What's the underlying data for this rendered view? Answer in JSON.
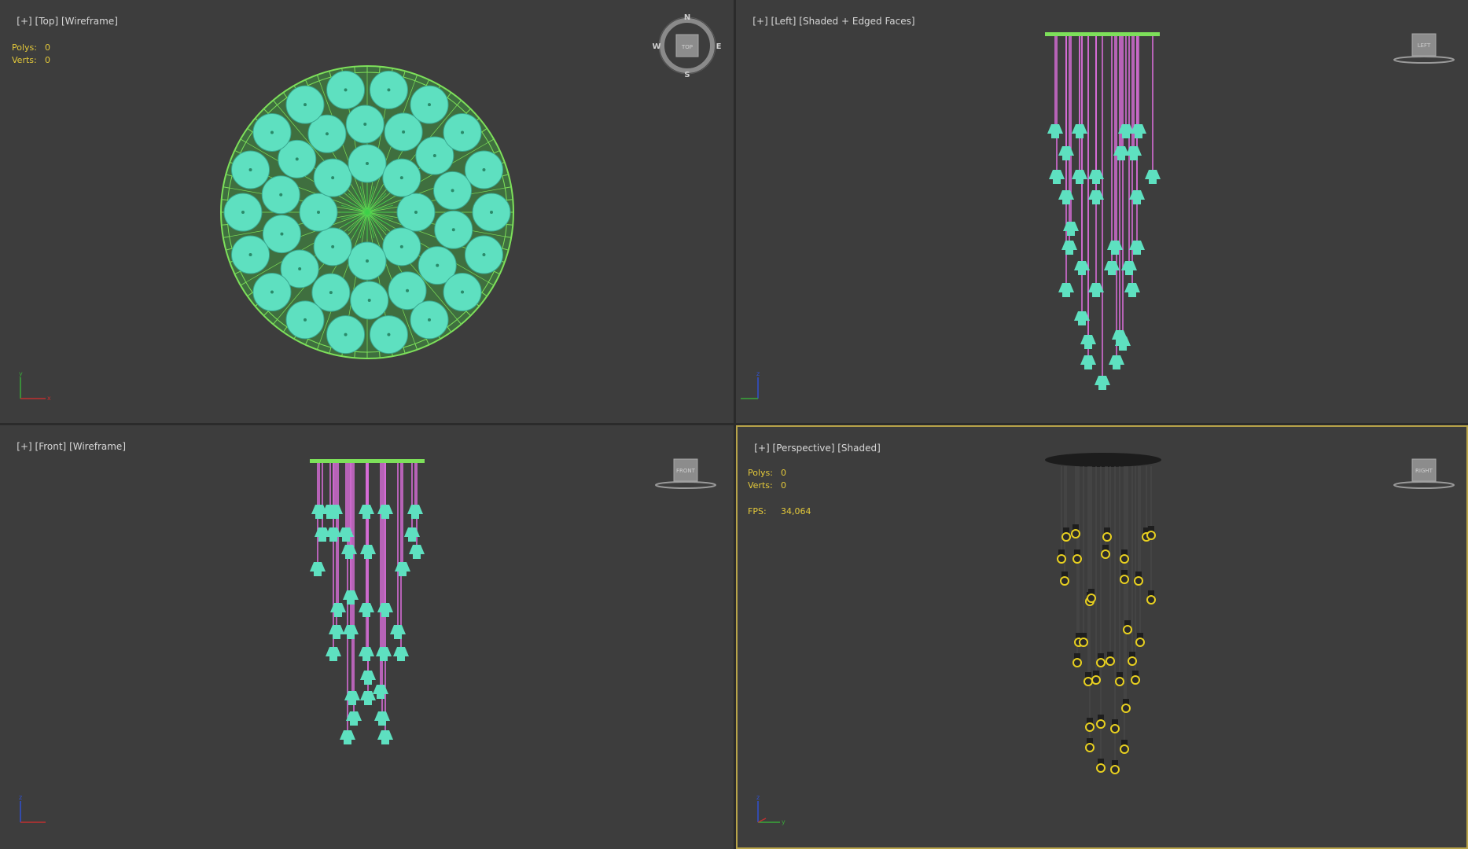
{
  "viewports": {
    "top": {
      "label": "[+] [Top] [Wireframe]",
      "label_parts": [
        "[+]",
        "[Top]",
        "[Wireframe]"
      ],
      "stats": {
        "polys_label": "Polys:",
        "polys": "0",
        "verts_label": "Verts:",
        "verts": "0"
      },
      "compass": {
        "n": "N",
        "s": "S",
        "e": "E",
        "w": "W",
        "center": "TOP"
      }
    },
    "left": {
      "label_parts": [
        "[+]",
        "[Left]",
        "[Shaded + Edged Faces]"
      ],
      "viewcube": "LEFT"
    },
    "front": {
      "label_parts": [
        "[+]",
        "[Front]",
        "[Wireframe]"
      ],
      "viewcube": "FRONT"
    },
    "perspective": {
      "label_parts": [
        "[+]",
        "[Perspective]",
        "[Shaded]"
      ],
      "viewcube": "RIGHT",
      "stats": {
        "polys_label": "Polys:",
        "polys": "0",
        "verts_label": "Verts:",
        "verts": "0",
        "fps_label": "FPS:",
        "fps": "34,064"
      }
    }
  },
  "colors": {
    "viewport_bg": "#3d3d3d",
    "wire_green": "#7de05a",
    "shade_cyan": "#5ee0c0",
    "cable_magenta": "#e070e0",
    "bulb_yellow": "#e8d020",
    "active_border": "#b8a44a",
    "stats_yellow": "#e4c93a"
  }
}
